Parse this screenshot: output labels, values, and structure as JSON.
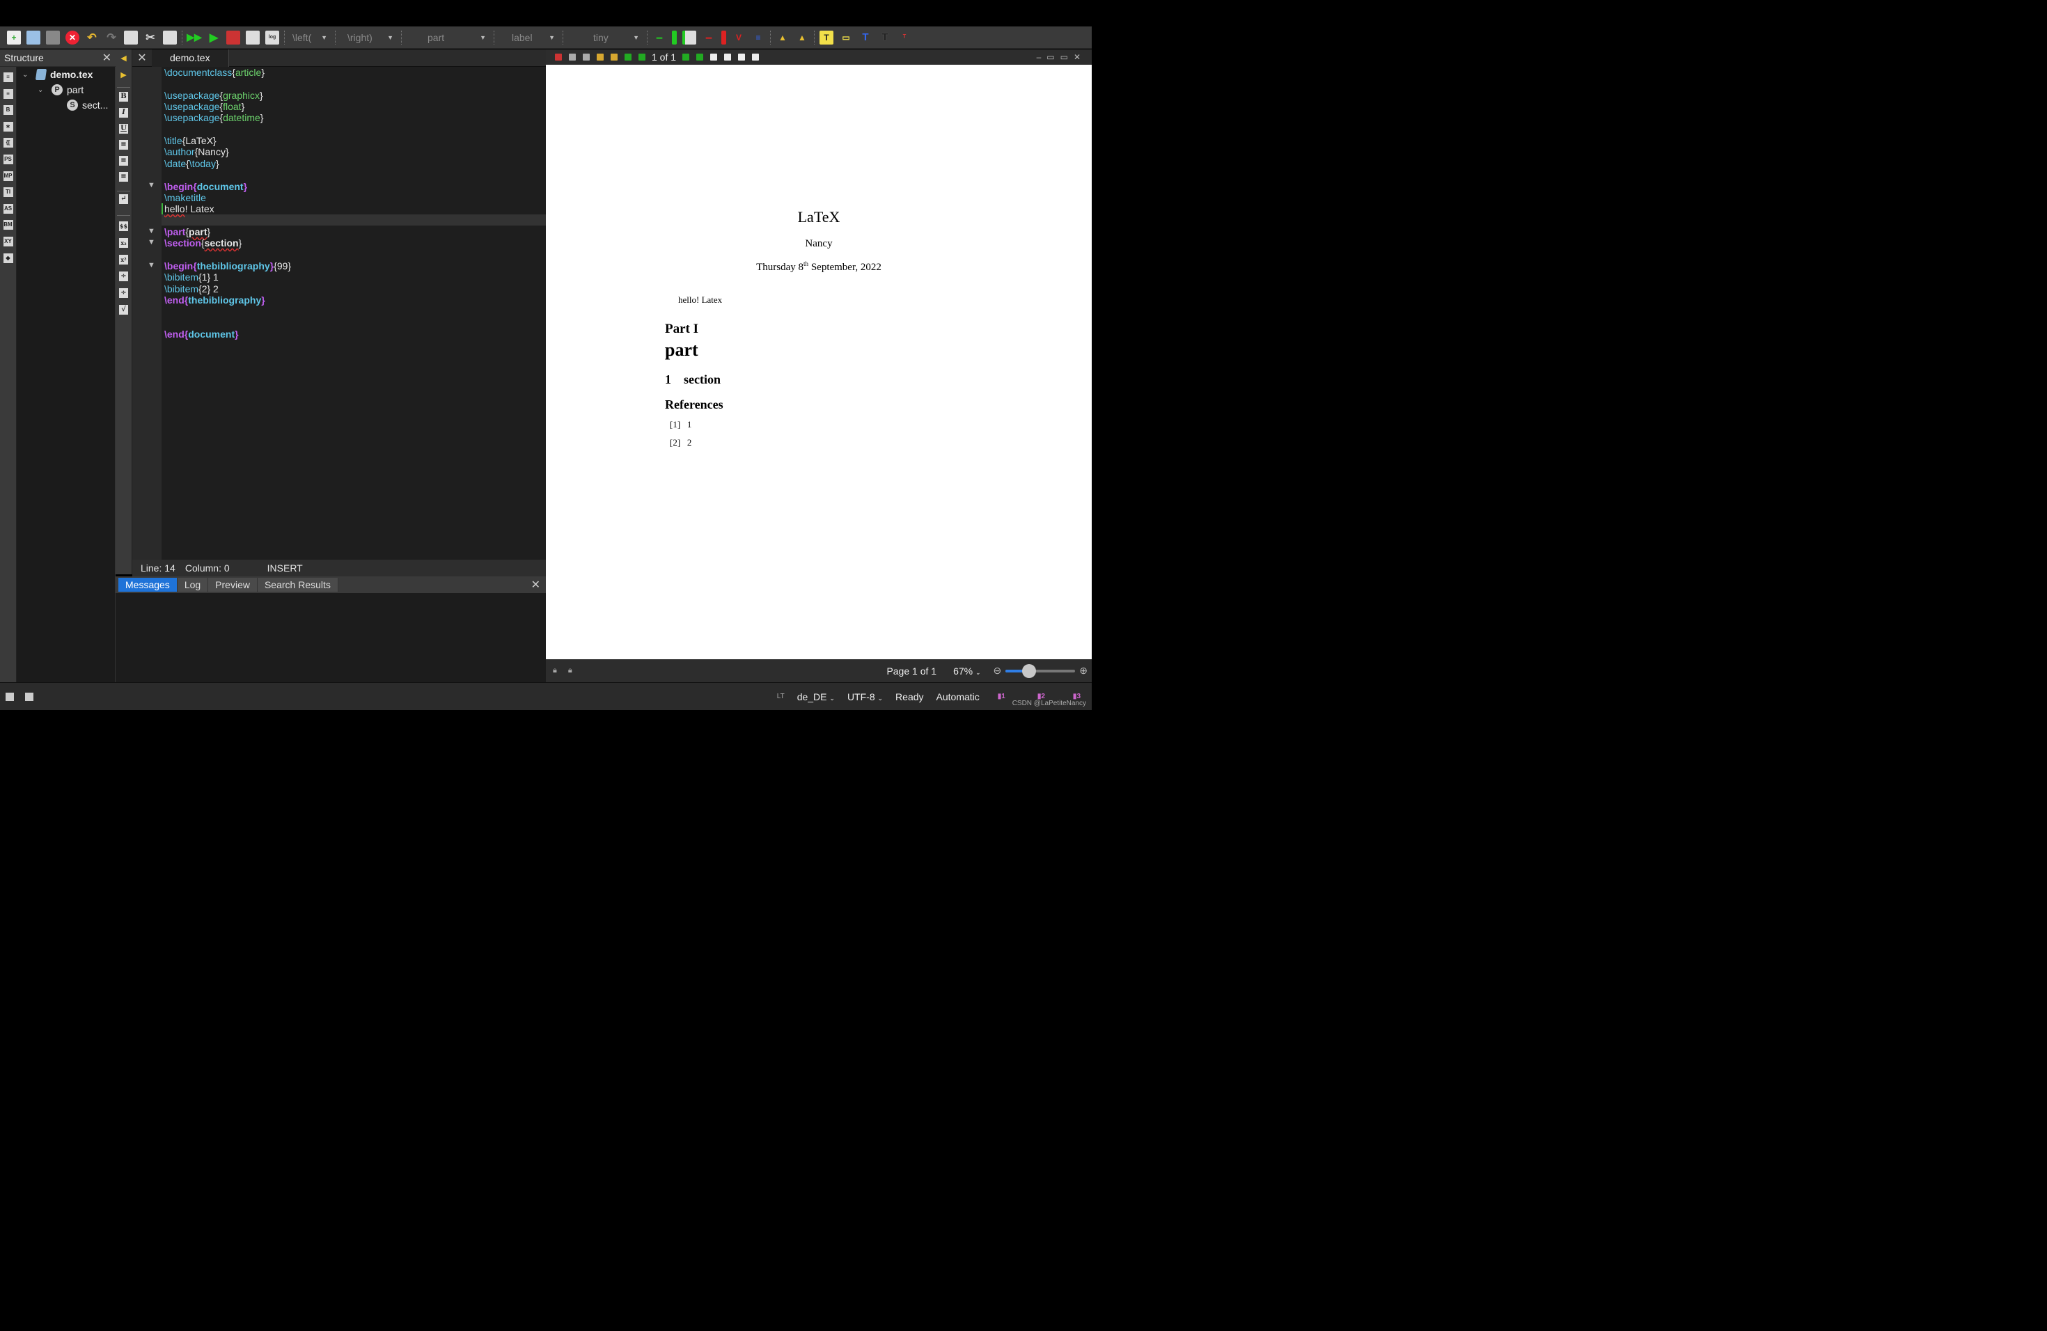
{
  "toolbar": {
    "left_combo": "\\left(",
    "right_combo": "\\right)",
    "structure_combo": "part",
    "ref_combo": "label",
    "size_combo": "tiny"
  },
  "structure": {
    "title": "Structure",
    "tree": [
      {
        "label": "demo.tex",
        "icon": "file-icon"
      },
      {
        "label": "part",
        "icon": "P"
      },
      {
        "label": "sect...",
        "icon": "S"
      }
    ]
  },
  "editor": {
    "tab_label": "demo.tex",
    "lines": [
      {
        "segments": [
          [
            "cmd",
            "\\documentclass"
          ],
          [
            "t",
            "{"
          ],
          [
            "arg",
            "article"
          ],
          [
            "t",
            "}"
          ]
        ]
      },
      {
        "segments": []
      },
      {
        "segments": [
          [
            "cmd",
            "\\usepackage"
          ],
          [
            "t",
            "{"
          ],
          [
            "arg",
            "graphicx"
          ],
          [
            "t",
            "}"
          ]
        ]
      },
      {
        "segments": [
          [
            "cmd",
            "\\usepackage"
          ],
          [
            "t",
            "{"
          ],
          [
            "arg",
            "float"
          ],
          [
            "t",
            "}"
          ]
        ]
      },
      {
        "segments": [
          [
            "cmd",
            "\\usepackage"
          ],
          [
            "t",
            "{"
          ],
          [
            "arg",
            "datetime"
          ],
          [
            "t",
            "}"
          ]
        ]
      },
      {
        "segments": []
      },
      {
        "segments": [
          [
            "cmd",
            "\\title"
          ],
          [
            "t",
            "{LaTeX}"
          ]
        ]
      },
      {
        "segments": [
          [
            "cmd",
            "\\author"
          ],
          [
            "t",
            "{Nancy}"
          ]
        ]
      },
      {
        "segments": [
          [
            "cmd",
            "\\date"
          ],
          [
            "t",
            "{"
          ],
          [
            "cmd",
            "\\today"
          ],
          [
            "t",
            "}"
          ]
        ]
      },
      {
        "segments": []
      },
      {
        "segments": [
          [
            "kw",
            "\\begin"
          ],
          [
            "kw",
            "{"
          ],
          [
            "kwa",
            "document"
          ],
          [
            "kw",
            "}"
          ]
        ]
      },
      {
        "segments": [
          [
            "cmd",
            "\\maketitle"
          ]
        ]
      },
      {
        "segments": [
          [
            "sq",
            "hello"
          ],
          [
            "t",
            "! Latex"
          ]
        ]
      },
      {
        "segments": []
      },
      {
        "segments": [
          [
            "kw",
            "\\part"
          ],
          [
            "t",
            "{"
          ],
          [
            "sq",
            "part"
          ],
          [
            "t",
            "}"
          ]
        ]
      },
      {
        "segments": [
          [
            "kw",
            "\\section"
          ],
          [
            "t",
            "{"
          ],
          [
            "sq",
            "section"
          ],
          [
            "t",
            "}"
          ]
        ]
      },
      {
        "segments": []
      },
      {
        "segments": [
          [
            "kw",
            "\\begin"
          ],
          [
            "kw",
            "{"
          ],
          [
            "kwa",
            "thebibliography"
          ],
          [
            "kw",
            "}"
          ],
          [
            "t",
            "{99}"
          ]
        ]
      },
      {
        "segments": [
          [
            "cmd",
            "\\bibitem"
          ],
          [
            "t",
            "{1} 1"
          ]
        ]
      },
      {
        "segments": [
          [
            "cmd",
            "\\bibitem"
          ],
          [
            "t",
            "{2} 2"
          ]
        ]
      },
      {
        "segments": [
          [
            "kw",
            "\\end"
          ],
          [
            "kw",
            "{"
          ],
          [
            "kwa",
            "thebibliography"
          ],
          [
            "kw",
            "}"
          ]
        ]
      },
      {
        "segments": []
      },
      {
        "segments": []
      },
      {
        "segments": [
          [
            "kw",
            "\\end"
          ],
          [
            "kw",
            "{"
          ],
          [
            "kwa",
            "document"
          ],
          [
            "kw",
            "}"
          ]
        ]
      }
    ],
    "status": {
      "line": "Line: 14",
      "column": "Column: 0",
      "mode": "INSERT"
    }
  },
  "messages": {
    "tabs": [
      "Messages",
      "Log",
      "Preview",
      "Search Results"
    ],
    "active": 0
  },
  "pdf": {
    "page_indicator": "1 of 1",
    "title": "LaTeX",
    "author": "Nancy",
    "date_pre": "Thursday 8",
    "date_sup": "th",
    "date_post": " September, 2022",
    "body": "hello! Latex",
    "part_label": "Part I",
    "part_title": "part",
    "section": "1 section",
    "refs_heading": "References",
    "bib": [
      "[1]  1",
      "[2]  2"
    ],
    "page_status": "Page 1 of 1",
    "zoom": "67%"
  },
  "bottom": {
    "lt": "LT",
    "language": "de_DE",
    "encoding": "UTF-8",
    "status": "Ready",
    "mode": "Automatic",
    "b1": "1",
    "b2": "2",
    "b3": "3",
    "watermark": "CSDN @LaPetiteNancy"
  }
}
